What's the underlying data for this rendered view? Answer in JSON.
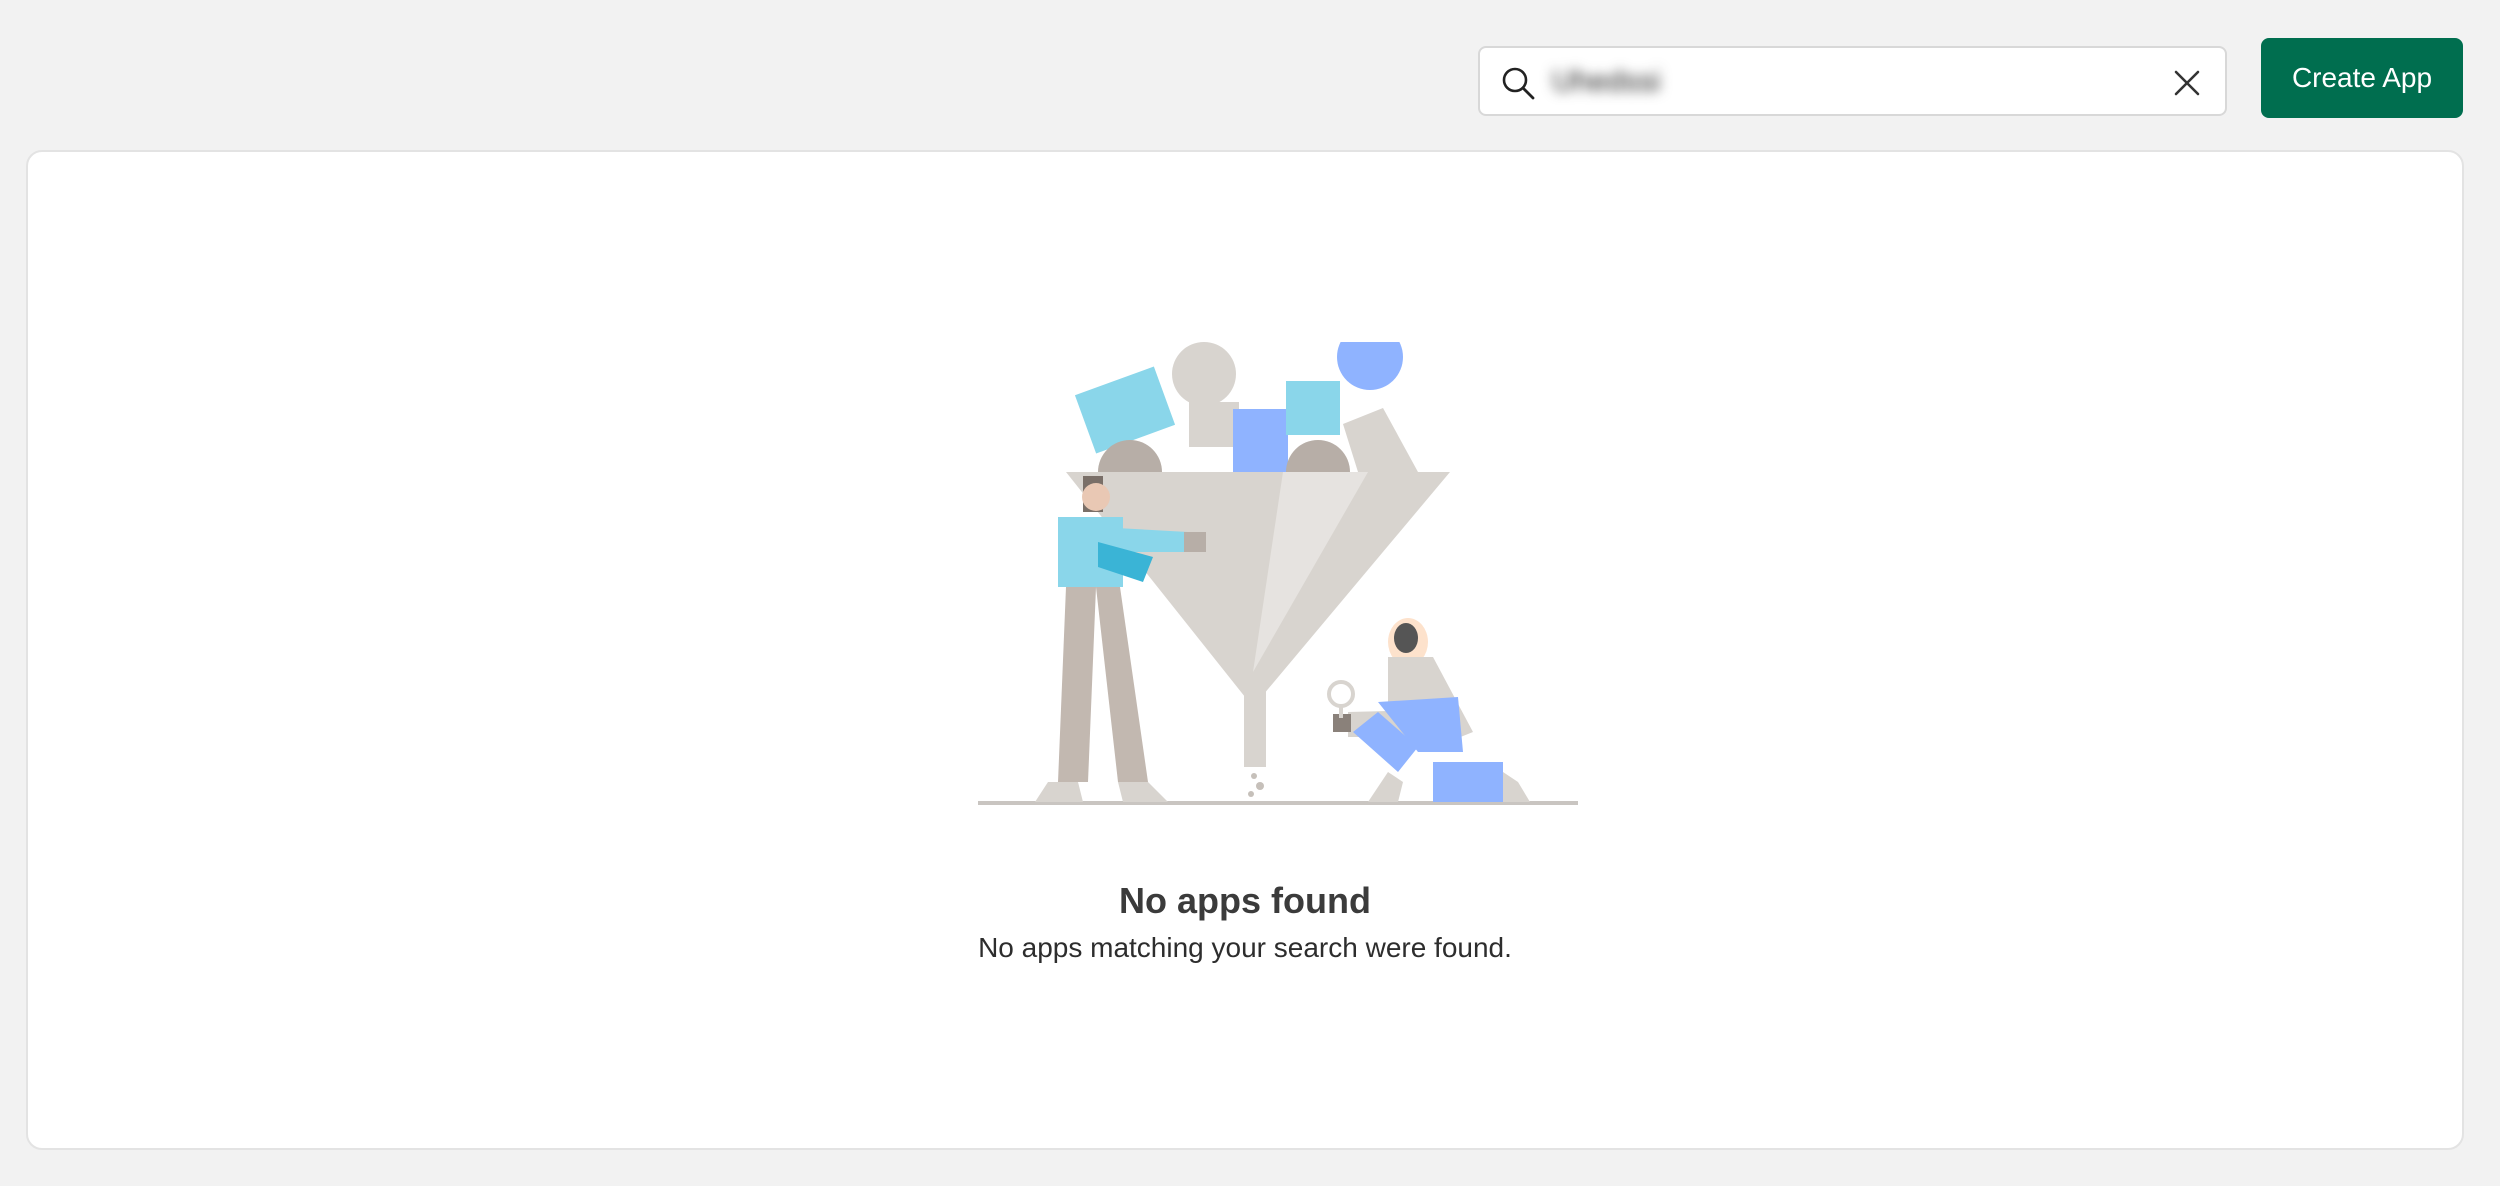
{
  "search": {
    "value": "Uhedssi",
    "placeholder": ""
  },
  "toolbar": {
    "create_label": "Create App"
  },
  "empty_state": {
    "title": "No apps found",
    "description": "No apps matching your search were found."
  },
  "colors": {
    "accent": "#006e4f",
    "page_bg": "#f2f2f2",
    "card_bg": "#ffffff"
  }
}
